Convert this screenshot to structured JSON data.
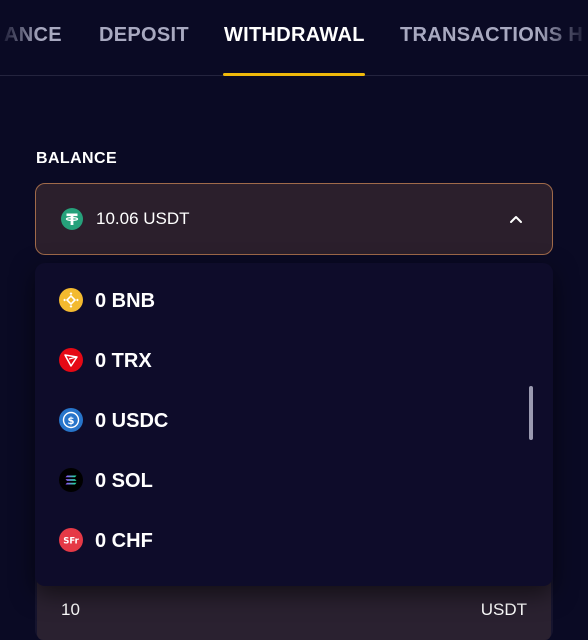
{
  "tabs": [
    {
      "label": "ANCE",
      "active": false
    },
    {
      "label": "DEPOSIT",
      "active": false
    },
    {
      "label": "WITHDRAWAL",
      "active": true
    },
    {
      "label": "TRANSACTIONS H",
      "active": false
    }
  ],
  "balance": {
    "label": "BALANCE",
    "selected_value": "10.06 USDT",
    "selected_icon": "tether-icon",
    "chevron": "chevron-up-icon"
  },
  "dropdown": {
    "options": [
      {
        "label": "0 BNB",
        "icon": "bnb-icon"
      },
      {
        "label": "0 TRX",
        "icon": "tron-icon"
      },
      {
        "label": "0 USDC",
        "icon": "usdc-icon"
      },
      {
        "label": "0 SOL",
        "icon": "solana-icon"
      },
      {
        "label": "0 CHF",
        "icon": "chf-icon",
        "icon_text": "SFr"
      }
    ]
  },
  "amount": {
    "value": "10",
    "unit": "USDT"
  },
  "colors": {
    "background": "#0a0a24",
    "accent": "#f0b90b",
    "select_border": "#a06a4a",
    "tether": "#26a17b",
    "bnb": "#f3ba2f",
    "tron": "#e50915",
    "usdc": "#2775ca",
    "chf": "#e53946"
  }
}
